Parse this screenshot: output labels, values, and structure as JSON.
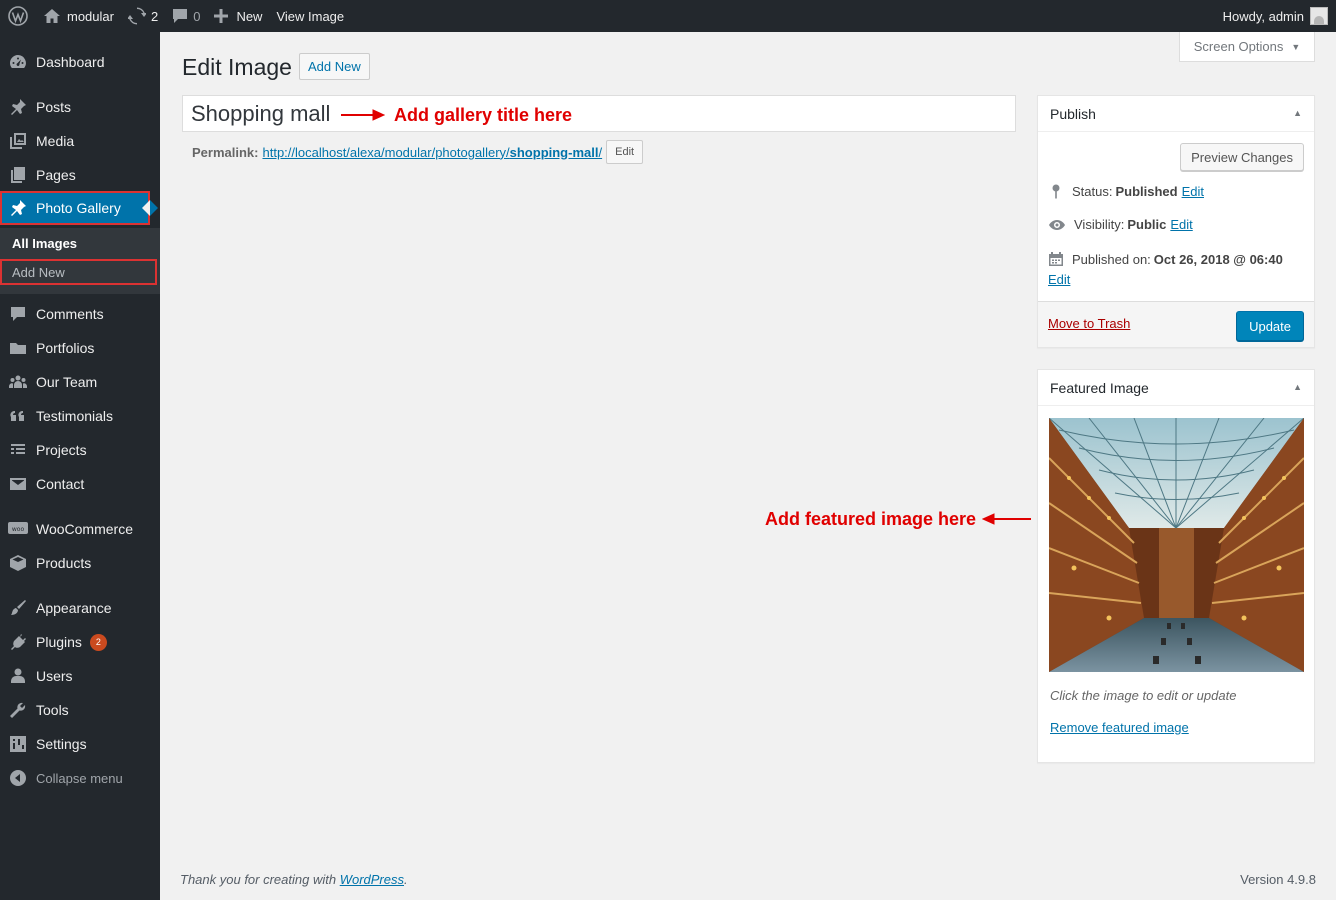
{
  "adminbar": {
    "site_name": "modular",
    "updates_count": "2",
    "comments_count": "0",
    "new_label": "New",
    "view_label": "View Image",
    "howdy": "Howdy, admin"
  },
  "sidebar": {
    "items": [
      {
        "label": "Dashboard",
        "icon": "dashboard-icon"
      },
      {
        "label": "Posts",
        "icon": "pin-icon"
      },
      {
        "label": "Media",
        "icon": "media-icon"
      },
      {
        "label": "Pages",
        "icon": "pages-icon"
      },
      {
        "label": "Photo Gallery",
        "icon": "pin-icon"
      },
      {
        "label": "Comments",
        "icon": "comment-icon"
      },
      {
        "label": "Portfolios",
        "icon": "folder-icon"
      },
      {
        "label": "Our Team",
        "icon": "groups-icon"
      },
      {
        "label": "Testimonials",
        "icon": "quote-icon"
      },
      {
        "label": "Projects",
        "icon": "list-icon"
      },
      {
        "label": "Contact",
        "icon": "email-icon"
      },
      {
        "label": "WooCommerce",
        "icon": "woo-icon"
      },
      {
        "label": "Products",
        "icon": "archive-icon"
      },
      {
        "label": "Appearance",
        "icon": "brush-icon"
      },
      {
        "label": "Plugins",
        "icon": "plug-icon",
        "badge": "2"
      },
      {
        "label": "Users",
        "icon": "users-icon"
      },
      {
        "label": "Tools",
        "icon": "wrench-icon"
      },
      {
        "label": "Settings",
        "icon": "settings-icon"
      }
    ],
    "submenu": {
      "all_images": "All Images",
      "add_new": "Add New"
    },
    "collapse": "Collapse menu"
  },
  "screen_options": "Screen Options",
  "page": {
    "title": "Edit Image",
    "add_new": "Add New"
  },
  "post": {
    "title": "Shopping mall",
    "permalink_label": "Permalink:",
    "permalink_base": "http://localhost/alexa/modular/photogallery/",
    "permalink_slug": "shopping-mall",
    "permalink_trailing": "/",
    "edit_button": "Edit"
  },
  "annotations": {
    "title_hint": "Add gallery title here",
    "featured_hint": "Add featured image here",
    "color": "#e00000"
  },
  "publish": {
    "heading": "Publish",
    "preview_button": "Preview Changes",
    "status_label": "Status:",
    "status_value": "Published",
    "visibility_label": "Visibility:",
    "visibility_value": "Public",
    "published_label": "Published on:",
    "published_value": "Oct 26, 2018 @ 06:40",
    "edit_link": "Edit",
    "trash_link": "Move to Trash",
    "update_button": "Update"
  },
  "featured": {
    "heading": "Featured Image",
    "hint": "Click the image to edit or update",
    "remove_link": "Remove featured image"
  },
  "footer": {
    "thanks_prefix": "Thank you for creating with ",
    "wordpress": "WordPress",
    "period": ".",
    "version": "Version 4.9.8"
  },
  "colors": {
    "adminbar_bg": "#23282d",
    "accent": "#0073aa",
    "primary_button": "#0085ba",
    "highlight_outline": "#dc3232"
  }
}
